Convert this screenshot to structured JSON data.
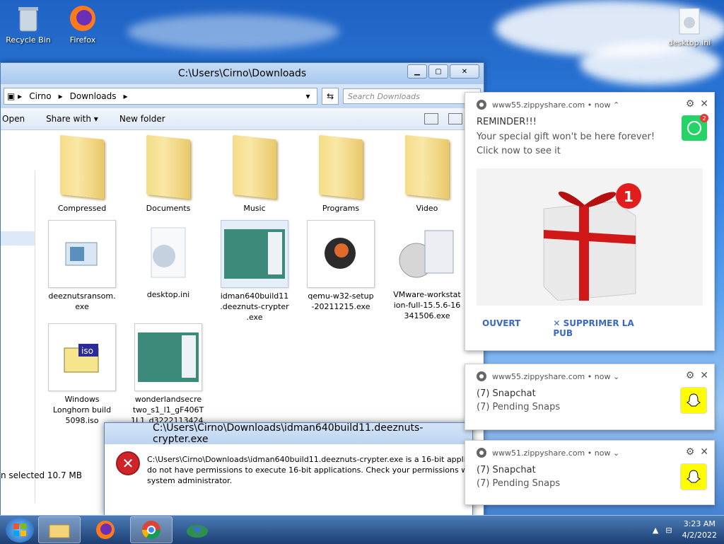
{
  "desktop": {
    "icons": [
      {
        "label": "Recycle Bin"
      },
      {
        "label": "Firefox"
      },
      {
        "label": "desktop.ini"
      }
    ]
  },
  "explorer": {
    "title": "C:\\Users\\Cirno\\Downloads",
    "breadcrumb": [
      "Cirno",
      "Downloads"
    ],
    "search_placeholder": "Search Downloads",
    "toolbar": {
      "open": "Open",
      "share_with": "Share with",
      "new_folder": "New folder"
    },
    "files": [
      {
        "name": "Compressed",
        "type": "folder"
      },
      {
        "name": "Documents",
        "type": "folder"
      },
      {
        "name": "Music",
        "type": "folder"
      },
      {
        "name": "Programs",
        "type": "folder"
      },
      {
        "name": "Video",
        "type": "folder"
      },
      {
        "name": "deeznutsransom.\nexe",
        "type": "exe"
      },
      {
        "name": "desktop.ini",
        "type": "ini"
      },
      {
        "name": "idman640build11\n.deeznuts-crypter\n.exe",
        "type": "exe-selected"
      },
      {
        "name": "qemu-w32-setup\n-20211215.exe",
        "type": "qemu"
      },
      {
        "name": "VMware-workstat\nion-full-15.5.6-16\n341506.exe",
        "type": "vmware"
      },
      {
        "name": "Windows\nLonghorn build\n5098.iso",
        "type": "iso"
      },
      {
        "name": "wonderlandsecre\ntwo_s1_l1_gF406T\n1L1_d3222113424.",
        "type": "image"
      }
    ],
    "status": "n selected  10.7 MB"
  },
  "error_dialog": {
    "title": "C:\\Users\\Cirno\\Downloads\\idman640build11.deeznuts-crypter.exe",
    "message": "C:\\Users\\Cirno\\Downloads\\idman640build11.deeznuts-crypter.exe is a 16-bit applicati\ndo not have permissions to execute 16-bit applications. Check your permissions with y\nsystem administrator."
  },
  "notifications": [
    {
      "site": "www55.zippyshare.com",
      "time": "now",
      "title": "REMINDER!!!",
      "body": "Your special gift won't be here forever! Click now to see it",
      "badge": "2",
      "action_open": "OUVERT",
      "action_remove": "SUPPRIMER LA PUB",
      "image_badge": "1"
    },
    {
      "site": "www55.zippyshare.com",
      "time": "now",
      "title": "(7) Snapchat",
      "body": "(7) Pending Snaps"
    },
    {
      "site": "www51.zippyshare.com",
      "time": "now",
      "title": "(7) Snapchat",
      "body": "(7) Pending Snaps"
    }
  ],
  "taskbar": {
    "time": "3:23 AM",
    "date": "4/2/2022"
  },
  "colors": {
    "accent": "#3a68c2",
    "error": "#d0242b",
    "whatsapp": "#25d366",
    "snapchat": "#fffc00"
  }
}
